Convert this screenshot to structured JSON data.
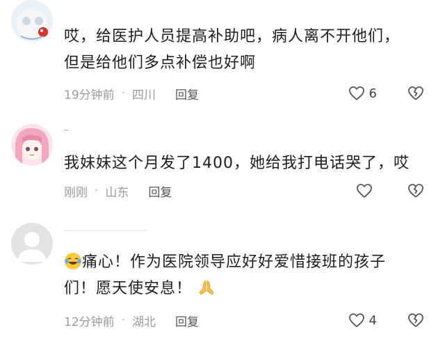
{
  "comments": [
    {
      "text_line1": "哎，给医护人员提高补助吧，病人离不开他们，",
      "text_line2": "但是给他们多点补偿也好啊",
      "time": "19分钟前",
      "location": "四川",
      "reply": "回复",
      "likes": "6",
      "avatar": "cartoon-avatar"
    },
    {
      "text_line1": "我妹妹这个月发了1400，她给我打电话哭了，哎",
      "time": "刚刚",
      "location": "山东",
      "reply": "回复",
      "likes": "",
      "avatar": "anime-girl-avatar"
    },
    {
      "text_main": "痛心！作为医院领导应好好爱惜接班的孩子",
      "text_line2": "们！愿天使安息！",
      "emoji_start": "laughing-tears-emoji",
      "emoji_end": "praying-hands-emoji",
      "time": "12分钟前",
      "location": "湖北",
      "reply": "回复",
      "likes": "4",
      "avatar": "default-avatar"
    }
  ],
  "icons": {
    "like": "heart-outline-icon",
    "dislike": "broken-heart-icon"
  },
  "colors": {
    "text": "#1d1d1d",
    "meta": "#9a9a9a",
    "reply": "#555555",
    "icon": "#555555"
  }
}
